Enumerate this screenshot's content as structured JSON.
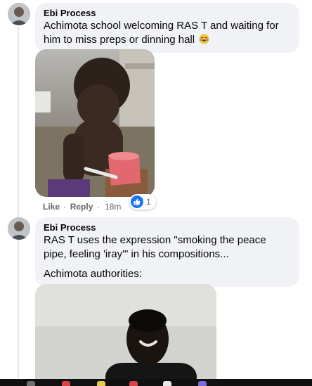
{
  "comments": [
    {
      "author": "Ebi Process",
      "text": "Achimota school welcoming RAS T and waiting for him to miss preps or dinning hall",
      "emoji_icon": "laughing-crying-face-icon",
      "actions": {
        "like": "Like",
        "reply": "Reply",
        "separator": "·",
        "time": "18m"
      },
      "reactions": {
        "icon": "like-thumb-icon",
        "count": "1"
      }
    },
    {
      "author": "Ebi Process",
      "lines": [
        "RAS T uses the expression \"smoking the peace pipe, feeling 'iray'\" in his compositions...",
        "Achimota authorities:"
      ]
    }
  ],
  "colors": {
    "bubble": "#f0f2f5",
    "secondary_text": "#65676b",
    "like_blue": "#1877f2",
    "thread_line": "#e4e6eb"
  }
}
